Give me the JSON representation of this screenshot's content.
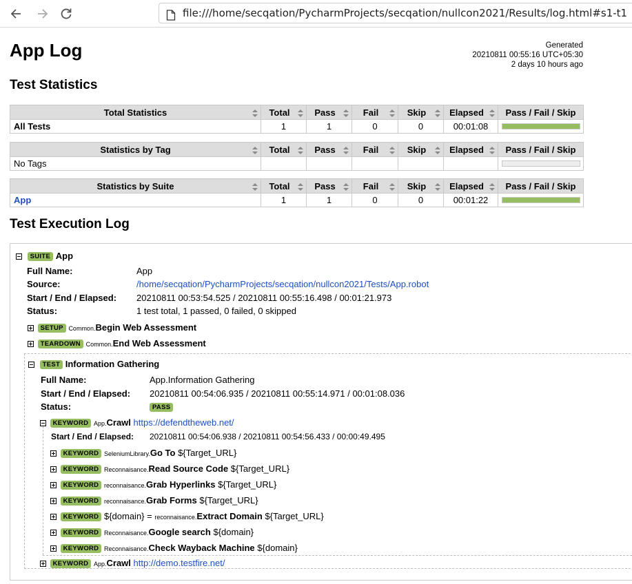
{
  "browser": {
    "url": "file:///home/secqation/PycharmProjects/secqation/nullcon2021/Results/log.html#s1-t1"
  },
  "header": {
    "title": "App Log",
    "generated_label": "Generated",
    "generated_time": "20210811 00:55:16 UTC+05:30",
    "generated_ago": "2 days 10 hours ago"
  },
  "statistics": {
    "heading": "Test Statistics",
    "columns": [
      "Total",
      "Pass",
      "Fail",
      "Skip",
      "Elapsed",
      "Pass / Fail / Skip"
    ],
    "total": {
      "header": "Total Statistics",
      "row": {
        "name": "All Tests",
        "total": "1",
        "pass": "1",
        "fail": "0",
        "skip": "0",
        "elapsed": "00:01:08",
        "pass_ratio": 1.0
      }
    },
    "tag": {
      "header": "Statistics by Tag",
      "row": {
        "name": "No Tags",
        "total": "",
        "pass": "",
        "fail": "",
        "skip": "",
        "elapsed": "",
        "pass_ratio": 0
      }
    },
    "suite": {
      "header": "Statistics by Suite",
      "row": {
        "name": "App",
        "total": "1",
        "pass": "1",
        "fail": "0",
        "skip": "0",
        "elapsed": "00:01:22",
        "pass_ratio": 1.0
      }
    }
  },
  "log": {
    "heading": "Test Execution Log",
    "suite": {
      "label": "SUITE",
      "name": "App",
      "full_name_key": "Full Name:",
      "full_name": "App",
      "source_key": "Source:",
      "source": "/home/secqation/PycharmProjects/secqation/nullcon2021/Tests/App.robot",
      "times_key": "Start / End / Elapsed:",
      "times": "20210811 00:53:54.525 / 20210811 00:55:16.498 / 00:01:21.973",
      "status_key": "Status:",
      "status": "1 test total, 1 passed, 0 failed, 0 skipped"
    },
    "setup": {
      "label": "SETUP",
      "parent": "Common",
      "name": "Begin Web Assessment"
    },
    "teardown": {
      "label": "TEARDOWN",
      "parent": "Common",
      "name": "End Web Assessment"
    },
    "test": {
      "label": "TEST",
      "name": "Information Gathering",
      "full_name_key": "Full Name:",
      "full_name": "App.Information Gathering",
      "times_key": "Start / End / Elapsed:",
      "times": "20210811 00:54:06.935 / 20210811 00:55:14.971 / 00:01:08.036",
      "status_key": "Status:",
      "status": "PASS"
    },
    "crawl1": {
      "label": "KEYWORD",
      "parent": "App",
      "name": "Crawl",
      "arg": "https://defendtheweb.net/",
      "times_key": "Start / End / Elapsed:",
      "times": "20210811 00:54:06.938 / 20210811 00:54:56.433 / 00:00:49.495"
    },
    "keywords": [
      {
        "label": "KEYWORD",
        "assign": "",
        "parent": "SeleniumLibrary",
        "name": "Go To",
        "args": "${Target_URL}"
      },
      {
        "label": "KEYWORD",
        "assign": "",
        "parent": "Reconnaisance",
        "name": "Read Source Code",
        "args": "${Target_URL}"
      },
      {
        "label": "KEYWORD",
        "assign": "",
        "parent": "reconnaisance",
        "name": "Grab Hyperlinks",
        "args": "${Target_URL}"
      },
      {
        "label": "KEYWORD",
        "assign": "",
        "parent": "reconnaisance",
        "name": "Grab Forms",
        "args": "${Target_URL}"
      },
      {
        "label": "KEYWORD",
        "assign": "${domain} =",
        "parent": "reconnaisance",
        "name": "Extract Domain",
        "args": "${Target_URL}"
      },
      {
        "label": "KEYWORD",
        "assign": "",
        "parent": "Reconnaisance",
        "name": "Google search",
        "args": "${domain}"
      },
      {
        "label": "KEYWORD",
        "assign": "",
        "parent": "Reconnaisance",
        "name": "Check Wayback Machine",
        "args": "${domain}"
      }
    ],
    "crawl2": {
      "label": "KEYWORD",
      "parent": "App",
      "name": "Crawl",
      "arg": "http://demo.testfire.net/"
    }
  },
  "colors": {
    "label_green": "#97bd61",
    "link_blue": "#1c4fc4",
    "table_header_bg": "#dddddd"
  },
  "icons": [
    "back-arrow-icon",
    "forward-arrow-icon",
    "reload-icon",
    "document-icon",
    "sort-icon",
    "expand-icon",
    "collapse-icon"
  ]
}
